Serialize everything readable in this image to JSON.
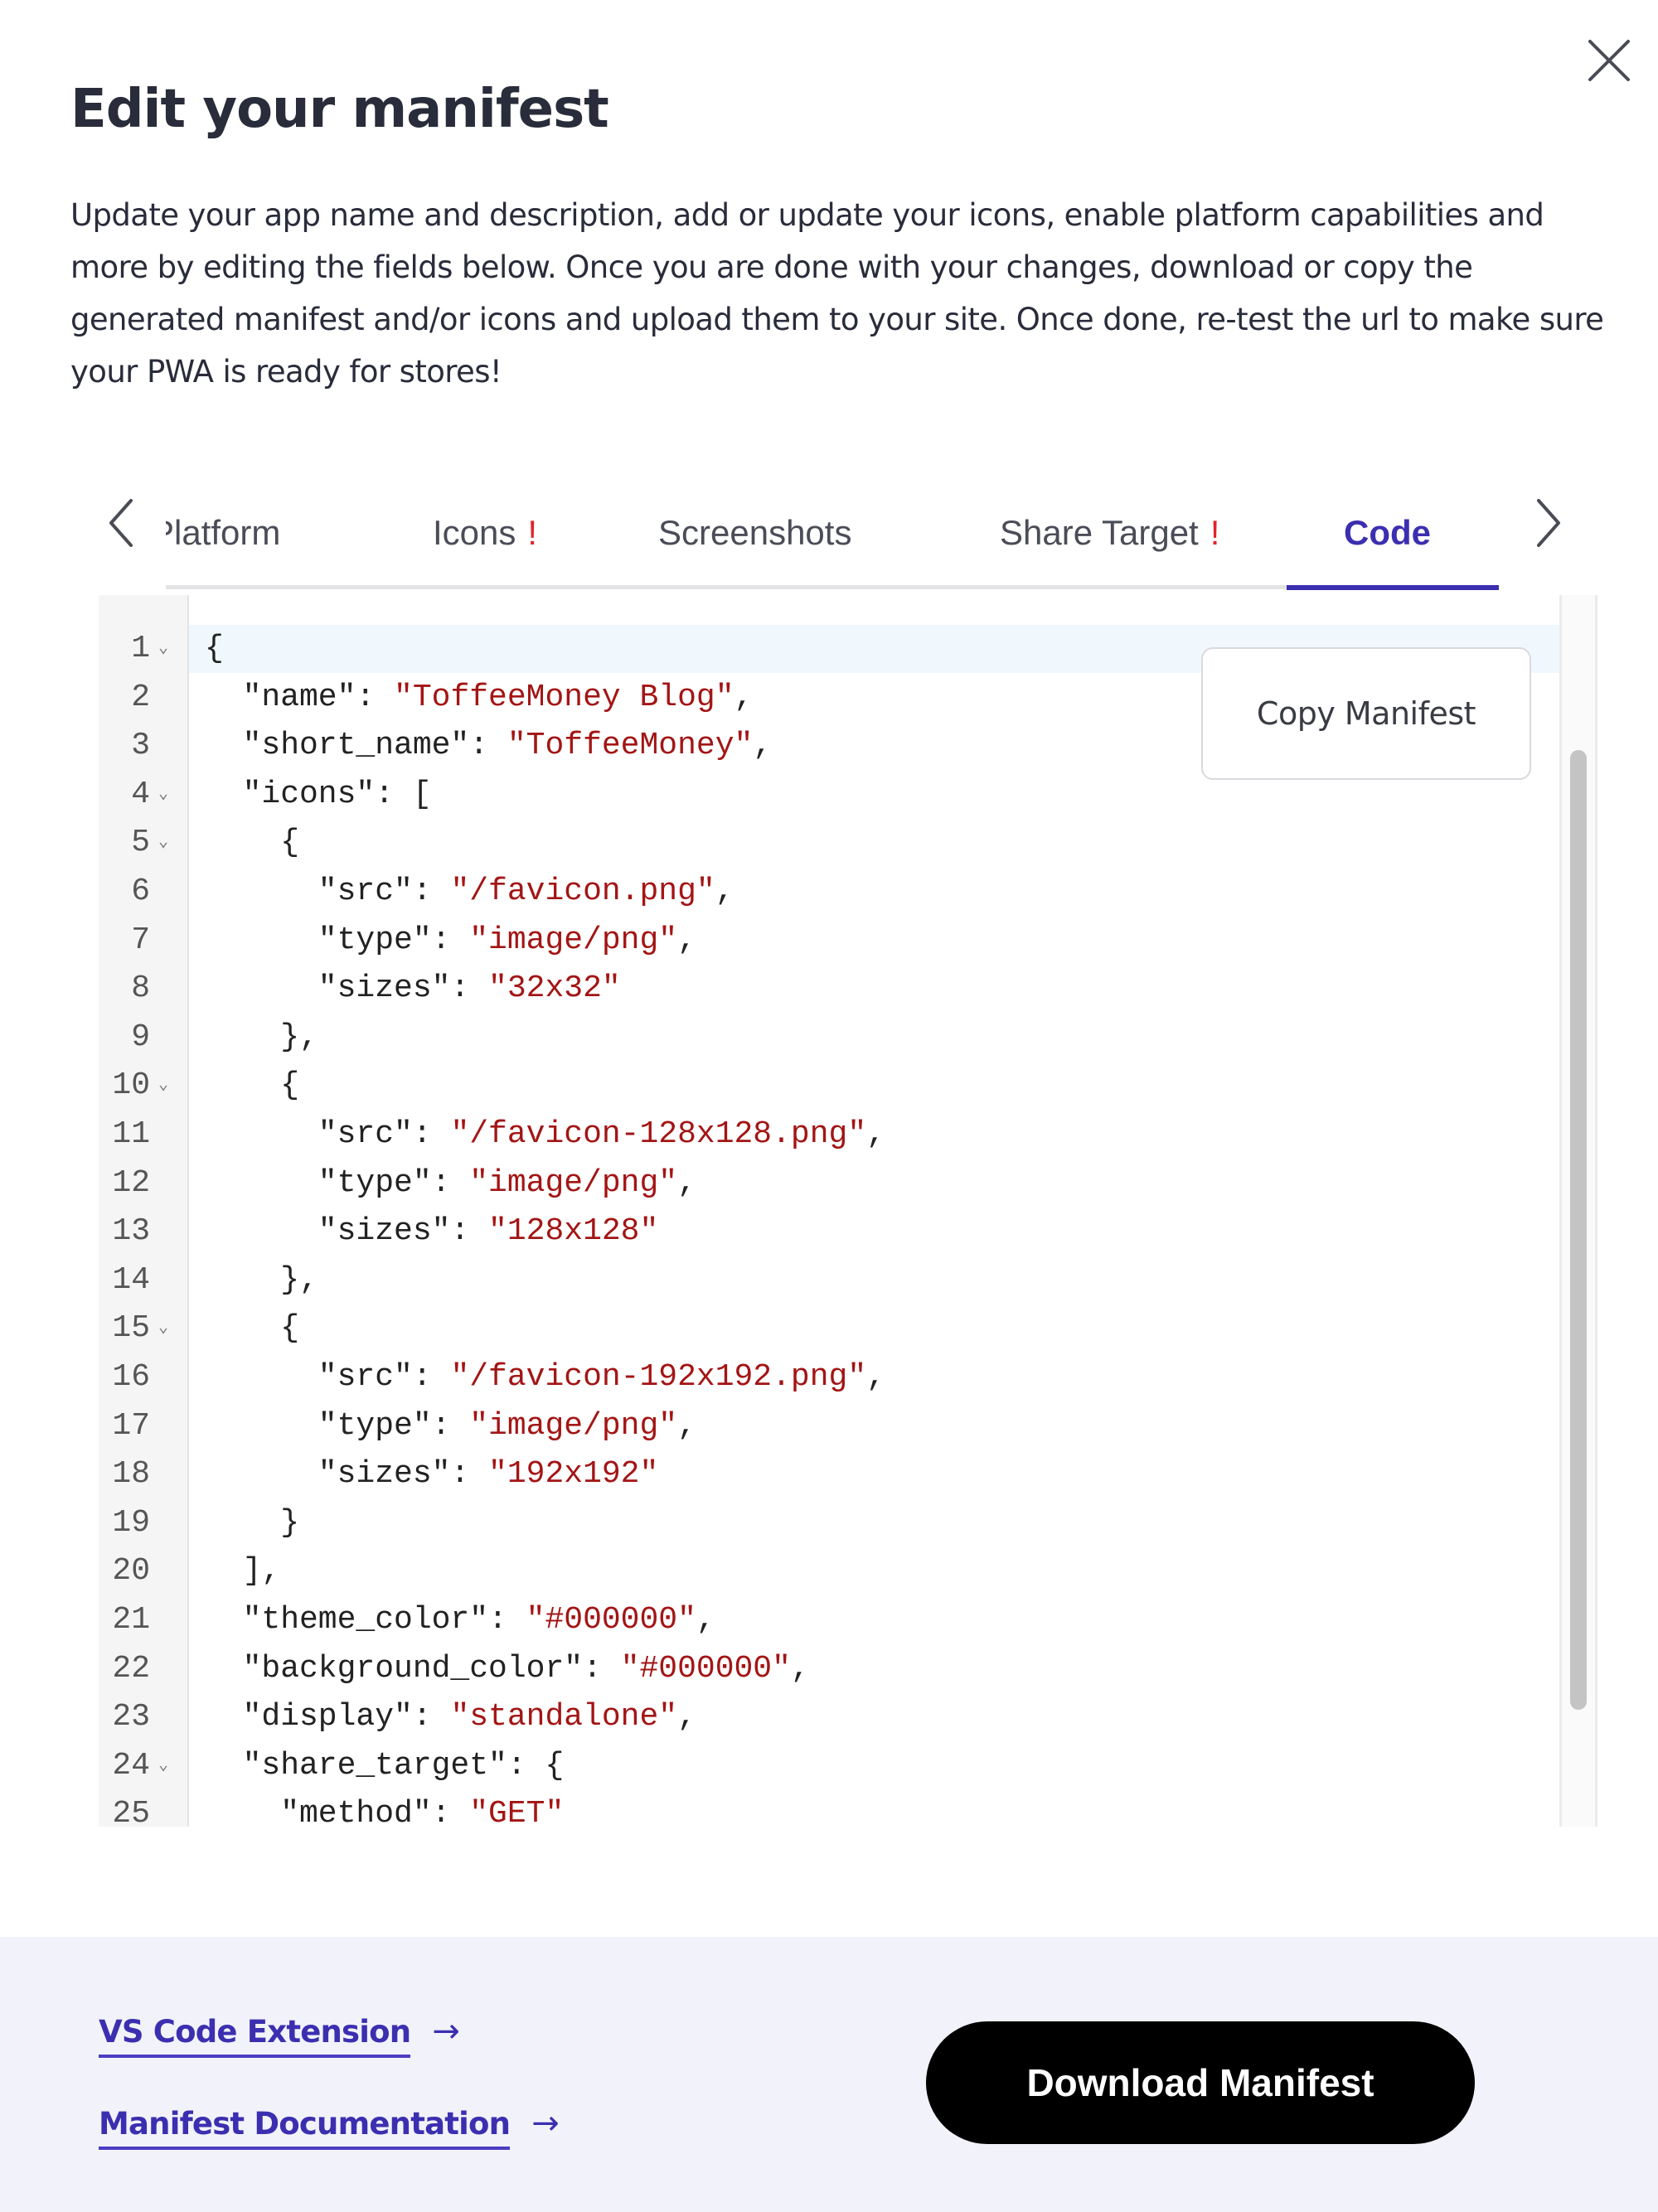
{
  "dialog": {
    "title": "Edit your manifest",
    "description": "Update your app name and description, add or update your icons, enable platform capabilities and more by editing the fields below. Once you are done with your changes, download or copy the generated manifest and/or icons and upload them to your site. Once done, re-test the url to make sure your PWA is ready for stores!",
    "close_icon": "close-icon"
  },
  "tabs": {
    "prev_icon": "chevron-left-icon",
    "next_icon": "chevron-right-icon",
    "items": [
      {
        "label": "Platform",
        "warning": "",
        "active": false
      },
      {
        "label": "Icons",
        "warning": "!",
        "active": false
      },
      {
        "label": "Screenshots",
        "warning": "",
        "active": false
      },
      {
        "label": "Share Target",
        "warning": "!",
        "active": false
      },
      {
        "label": "Code",
        "warning": "",
        "active": true
      }
    ],
    "active_color": "#3b2fb0",
    "warning_color": "#e0242a"
  },
  "editor": {
    "copy_label": "Copy Manifest",
    "lines": [
      {
        "n": "1",
        "fold": true,
        "indent": 0,
        "key": "",
        "sep": "",
        "value": "",
        "tail": "{"
      },
      {
        "n": "2",
        "fold": false,
        "indent": 2,
        "key": "\"name\"",
        "sep": ": ",
        "value": "\"ToffeeMoney Blog\"",
        "tail": ","
      },
      {
        "n": "3",
        "fold": false,
        "indent": 2,
        "key": "\"short_name\"",
        "sep": ": ",
        "value": "\"ToffeeMoney\"",
        "tail": ","
      },
      {
        "n": "4",
        "fold": true,
        "indent": 2,
        "key": "\"icons\"",
        "sep": ": ",
        "value": "",
        "tail": "["
      },
      {
        "n": "5",
        "fold": true,
        "indent": 4,
        "key": "",
        "sep": "",
        "value": "",
        "tail": "{"
      },
      {
        "n": "6",
        "fold": false,
        "indent": 6,
        "key": "\"src\"",
        "sep": ": ",
        "value": "\"/favicon.png\"",
        "tail": ","
      },
      {
        "n": "7",
        "fold": false,
        "indent": 6,
        "key": "\"type\"",
        "sep": ": ",
        "value": "\"image/png\"",
        "tail": ","
      },
      {
        "n": "8",
        "fold": false,
        "indent": 6,
        "key": "\"sizes\"",
        "sep": ": ",
        "value": "\"32x32\"",
        "tail": ""
      },
      {
        "n": "9",
        "fold": false,
        "indent": 4,
        "key": "",
        "sep": "",
        "value": "",
        "tail": "},"
      },
      {
        "n": "10",
        "fold": true,
        "indent": 4,
        "key": "",
        "sep": "",
        "value": "",
        "tail": "{"
      },
      {
        "n": "11",
        "fold": false,
        "indent": 6,
        "key": "\"src\"",
        "sep": ": ",
        "value": "\"/favicon-128x128.png\"",
        "tail": ","
      },
      {
        "n": "12",
        "fold": false,
        "indent": 6,
        "key": "\"type\"",
        "sep": ": ",
        "value": "\"image/png\"",
        "tail": ","
      },
      {
        "n": "13",
        "fold": false,
        "indent": 6,
        "key": "\"sizes\"",
        "sep": ": ",
        "value": "\"128x128\"",
        "tail": ""
      },
      {
        "n": "14",
        "fold": false,
        "indent": 4,
        "key": "",
        "sep": "",
        "value": "",
        "tail": "},"
      },
      {
        "n": "15",
        "fold": true,
        "indent": 4,
        "key": "",
        "sep": "",
        "value": "",
        "tail": "{"
      },
      {
        "n": "16",
        "fold": false,
        "indent": 6,
        "key": "\"src\"",
        "sep": ": ",
        "value": "\"/favicon-192x192.png\"",
        "tail": ","
      },
      {
        "n": "17",
        "fold": false,
        "indent": 6,
        "key": "\"type\"",
        "sep": ": ",
        "value": "\"image/png\"",
        "tail": ","
      },
      {
        "n": "18",
        "fold": false,
        "indent": 6,
        "key": "\"sizes\"",
        "sep": ": ",
        "value": "\"192x192\"",
        "tail": ""
      },
      {
        "n": "19",
        "fold": false,
        "indent": 4,
        "key": "",
        "sep": "",
        "value": "",
        "tail": "}"
      },
      {
        "n": "20",
        "fold": false,
        "indent": 2,
        "key": "",
        "sep": "",
        "value": "",
        "tail": "],"
      },
      {
        "n": "21",
        "fold": false,
        "indent": 2,
        "key": "\"theme_color\"",
        "sep": ": ",
        "value": "\"#000000\"",
        "tail": ","
      },
      {
        "n": "22",
        "fold": false,
        "indent": 2,
        "key": "\"background_color\"",
        "sep": ": ",
        "value": "\"#000000\"",
        "tail": ","
      },
      {
        "n": "23",
        "fold": false,
        "indent": 2,
        "key": "\"display\"",
        "sep": ": ",
        "value": "\"standalone\"",
        "tail": ","
      },
      {
        "n": "24",
        "fold": true,
        "indent": 2,
        "key": "\"share_target\"",
        "sep": ": ",
        "value": "",
        "tail": "{"
      },
      {
        "n": "25",
        "fold": false,
        "indent": 4,
        "key": "\"method\"",
        "sep": ": ",
        "value": "\"GET\"",
        "tail": ""
      }
    ],
    "string_color": "#a31515"
  },
  "footer": {
    "links": [
      {
        "label": "VS Code Extension",
        "arrow": "→"
      },
      {
        "label": "Manifest Documentation",
        "arrow": "→"
      }
    ],
    "download_label": "Download Manifest"
  }
}
